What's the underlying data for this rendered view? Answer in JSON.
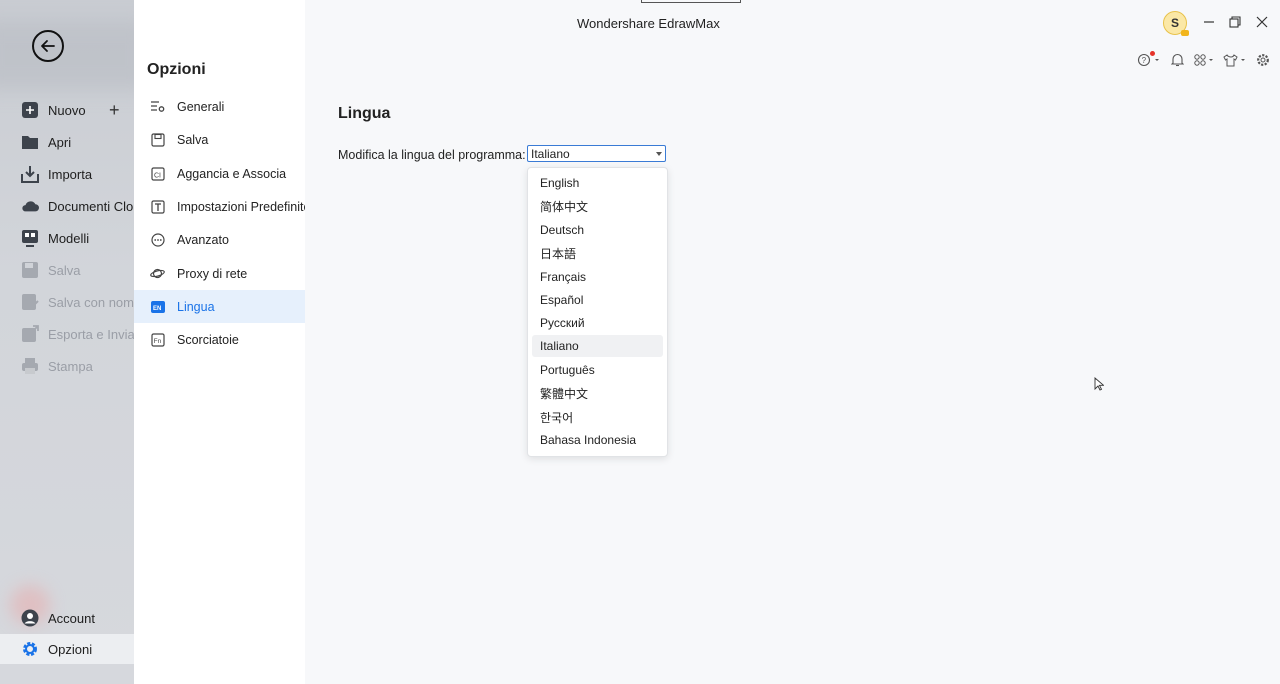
{
  "window": {
    "title": "Wondershare EdrawMax",
    "avatar_letter": "S"
  },
  "left_nav": {
    "items": [
      {
        "label": "Nuovo",
        "icon": "new-file-icon",
        "enabled": true
      },
      {
        "label": "Apri",
        "icon": "folder-icon",
        "enabled": true
      },
      {
        "label": "Importa",
        "icon": "import-icon",
        "enabled": true
      },
      {
        "label": "Documenti Cloud",
        "icon": "cloud-icon",
        "enabled": true
      },
      {
        "label": "Modelli",
        "icon": "templates-icon",
        "enabled": true
      },
      {
        "label": "Salva",
        "icon": "save-icon",
        "enabled": false
      },
      {
        "label": "Salva con nome",
        "icon": "save-as-icon",
        "enabled": false
      },
      {
        "label": "Esporta e Invia",
        "icon": "export-icon",
        "enabled": false
      },
      {
        "label": "Stampa",
        "icon": "print-icon",
        "enabled": false
      }
    ],
    "bottom": [
      {
        "label": "Account",
        "icon": "account-icon"
      },
      {
        "label": "Opzioni",
        "icon": "gear-icon"
      }
    ]
  },
  "options": {
    "title": "Opzioni",
    "items": [
      {
        "label": "Generali",
        "icon": "general-settings-icon"
      },
      {
        "label": "Salva",
        "icon": "save-icon"
      },
      {
        "label": "Aggancia e Associa",
        "icon": "snap-icon"
      },
      {
        "label": "Impostazioni Predefinite",
        "icon": "text-default-icon"
      },
      {
        "label": "Avanzato",
        "icon": "advanced-icon"
      },
      {
        "label": "Proxy di rete",
        "icon": "proxy-icon"
      },
      {
        "label": "Lingua",
        "icon": "language-icon",
        "selected": true
      },
      {
        "label": "Scorciatoie",
        "icon": "shortcut-icon"
      }
    ]
  },
  "language": {
    "section_title": "Lingua",
    "field_label": "Modifica la lingua del programma:",
    "selected": "Italiano",
    "options": [
      "English",
      "简体中文",
      "Deutsch",
      "日本語",
      "Français",
      "Español",
      "Русский",
      "Italiano",
      "Português",
      "繁體中文",
      "한국어",
      "Bahasa Indonesia"
    ]
  },
  "colors": {
    "accent": "#1a73e8",
    "selected_bg": "#e6f0fc"
  }
}
